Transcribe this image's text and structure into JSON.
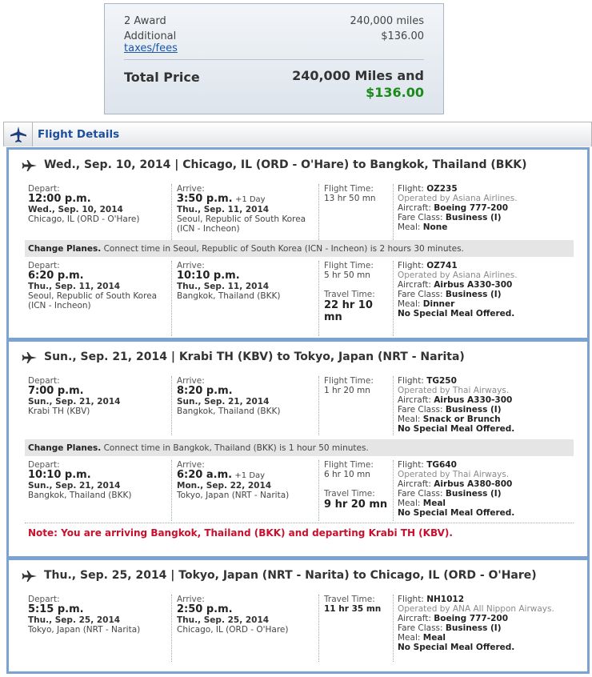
{
  "price": {
    "award_label": "2 Award",
    "award_miles": "240,000 miles",
    "additional_label": "Additional",
    "taxes_link": "taxes/fees",
    "taxes_amount": "$136.00",
    "total_label": "Total Price",
    "total_miles": "240,000 Miles and",
    "total_money": "$136.00"
  },
  "header": {
    "title": "Flight Details"
  },
  "labels": {
    "depart": "Depart:",
    "arrive": "Arrive:",
    "flight_time": "Flight Time:",
    "travel_time": "Travel Time:",
    "flight": "Flight:",
    "aircraft": "Aircraft:",
    "fare_class": "Fare Class:",
    "meal": "Meal:",
    "change_planes": "Change Planes.",
    "plus_day": "+1 Day"
  },
  "trips": [
    {
      "title": "Wed., Sep. 10, 2014 | Chicago, IL (ORD - O'Hare) to Bangkok, Thailand (BKK)",
      "segments": [
        {
          "dep_time": "12:00 p.m.",
          "dep_date": "Wed., Sep. 10, 2014",
          "dep_place": "Chicago, IL (ORD - O'Hare)",
          "arr_time": "3:50 p.m.",
          "arr_date": "Thu., Sep. 11, 2014",
          "arr_place": "Seoul, Republic of South Korea (ICN - Incheon)",
          "flight_time": "13 hr 50 mn",
          "flight": "OZ235",
          "operated": "Operated by Asiana Airlines.",
          "aircraft": "Boeing 777-200",
          "fare_class": "Business (I)",
          "meal": "None"
        },
        {
          "dep_time": "6:20 p.m.",
          "dep_date": "Thu., Sep. 11, 2014",
          "dep_place": "Seoul, Republic of South Korea (ICN - Incheon)",
          "arr_time": "10:10 p.m.",
          "arr_date": "Thu., Sep. 11, 2014",
          "arr_place": "Bangkok, Thailand (BKK)",
          "flight_time": "5 hr 50 mn",
          "travel_time": "22 hr 10 mn",
          "flight": "OZ741",
          "operated": "Operated by Asiana Airlines.",
          "aircraft": "Airbus A330-300",
          "fare_class": "Business (I)",
          "meal": "Dinner",
          "special": "No Special Meal Offered."
        }
      ],
      "change": "Connect time in Seoul, Republic of South Korea (ICN - Incheon) is 2 hours 30 minutes."
    },
    {
      "title": "Sun., Sep. 21, 2014 | Krabi TH (KBV) to Tokyo, Japan (NRT - Narita)",
      "segments": [
        {
          "dep_time": "7:00 p.m.",
          "dep_date": "Sun., Sep. 21, 2014",
          "dep_place": "Krabi TH (KBV)",
          "arr_time": "8:20 p.m.",
          "arr_date": "Sun., Sep. 21, 2014",
          "arr_place": "Bangkok, Thailand (BKK)",
          "flight_time": "1 hr 20 mn",
          "flight": "TG250",
          "operated": "Operated by Thai Airways.",
          "aircraft": "Airbus A330-300",
          "fare_class": "Business (I)",
          "meal": "Snack or Brunch",
          "special": "No Special Meal Offered."
        },
        {
          "dep_time": "10:10 p.m.",
          "dep_date": "Sun., Sep. 21, 2014",
          "dep_place": "Bangkok, Thailand (BKK)",
          "arr_time": "6:20 a.m.",
          "arr_date": "Mon., Sep. 22, 2014",
          "arr_place": "Tokyo, Japan (NRT - Narita)",
          "flight_time": "6 hr 10 mn",
          "travel_time": "9 hr 20 mn",
          "flight": "TG640",
          "operated": "Operated by Thai Airways.",
          "aircraft": "Airbus A380-800",
          "fare_class": "Business (I)",
          "meal": "Meal",
          "special": "No Special Meal Offered."
        }
      ],
      "change": "Connect time in Bangkok, Thailand (BKK) is 1 hour 50 minutes.",
      "note": "Note: You are arriving Bangkok, Thailand (BKK) and departing Krabi TH (KBV)."
    },
    {
      "title": "Thu., Sep. 25, 2014 | Tokyo, Japan (NRT - Narita) to Chicago, IL (ORD - O'Hare)",
      "segments": [
        {
          "dep_time": "5:15 p.m.",
          "dep_date": "Thu., Sep. 25, 2014",
          "dep_place": "Tokyo, Japan (NRT - Narita)",
          "arr_time": "2:50 p.m.",
          "arr_date": "Thu., Sep. 25, 2014",
          "arr_place": "Chicago, IL (ORD - O'Hare)",
          "flight_time": "11 hr 35 mn",
          "flight": "NH1012",
          "operated": "Operated by ANA All Nippon Airways.",
          "aircraft": "Boeing 777-200",
          "fare_class": "Business (I)",
          "meal": "Meal",
          "special": "No Special Meal Offered."
        }
      ]
    }
  ],
  "colors": {
    "accent": "#1e4f9c",
    "border": "#7aa3d2",
    "money": "#1a8a1a",
    "note": "#c8102e"
  },
  "icons": {
    "plane": "airplane-icon"
  }
}
